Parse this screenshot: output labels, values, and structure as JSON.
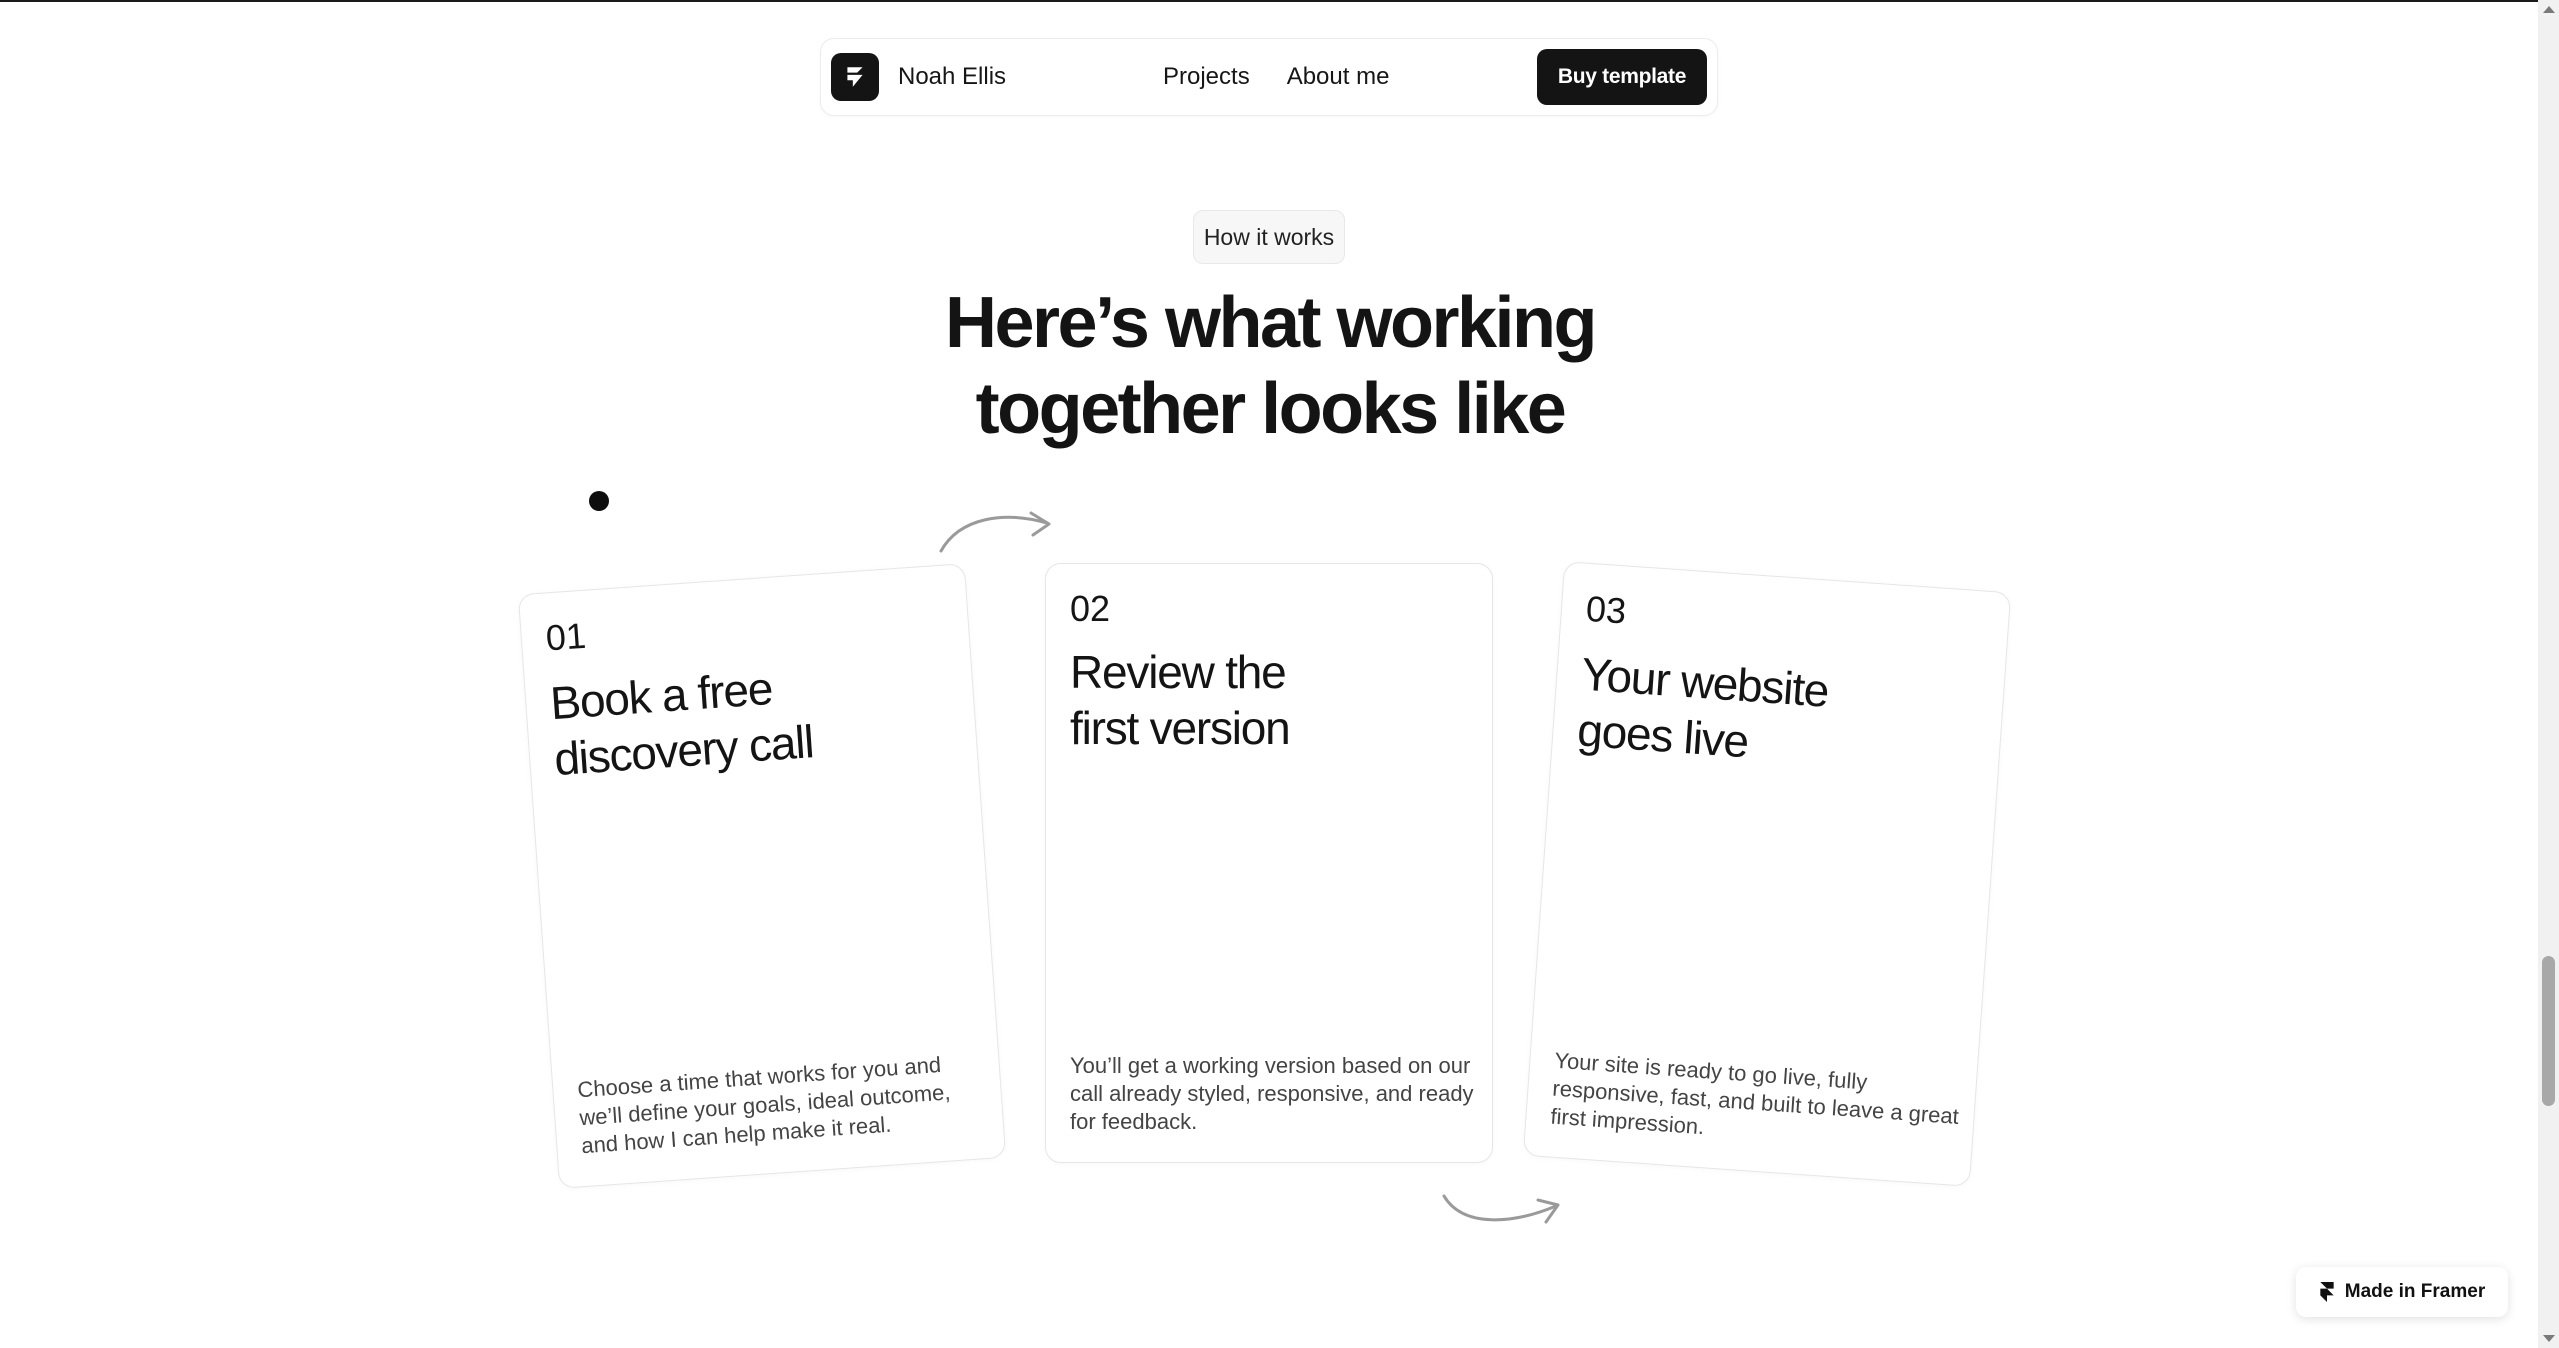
{
  "nav": {
    "brand": "Noah Ellis",
    "logo_icon": "framer-logo-icon",
    "links": [
      "Projects",
      "About me"
    ],
    "cta": "Buy template"
  },
  "section": {
    "badge": "How it works",
    "headline_line1": "Here’s what working",
    "headline_line2": "together looks like"
  },
  "steps": [
    {
      "number": "01",
      "title_line1": "Book a free",
      "title_line2": "discovery call",
      "description": "Choose a time that works for you and we’ll define your goals, ideal outcome, and how I can help make it real."
    },
    {
      "number": "02",
      "title_line1": "Review the",
      "title_line2": "first version",
      "description": "You’ll get a working version based on our call already styled, responsive, and ready for feedback."
    },
    {
      "number": "03",
      "title_line1": "Your website",
      "title_line2": "goes live",
      "description": "Your site is ready to go live, fully responsive, fast, and built to leave a great first impression."
    }
  ],
  "framer_badge": {
    "label": "Made in Framer",
    "icon": "framer-icon"
  },
  "colors": {
    "primary": "#141414",
    "background": "#ffffff",
    "muted_text": "#444444",
    "arrow": "#9a9a9a"
  }
}
